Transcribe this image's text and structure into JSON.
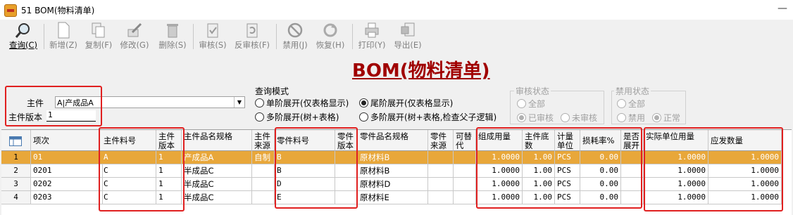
{
  "window": {
    "title": "51 BOM(物料清单)",
    "close_glyph": "—"
  },
  "toolbar": {
    "items": [
      {
        "label": "查询(C)",
        "icon": "magnifier-icon"
      },
      {
        "label": "新增(Z)",
        "icon": "new-doc-icon"
      },
      {
        "label": "复制(F)",
        "icon": "copy-icon"
      },
      {
        "label": "修改(G)",
        "icon": "edit-icon"
      },
      {
        "label": "删除(S)",
        "icon": "trash-icon"
      },
      {
        "label": "审核(S)",
        "icon": "approve-icon"
      },
      {
        "label": "反审核(F)",
        "icon": "unapprove-icon"
      },
      {
        "label": "禁用(J)",
        "icon": "disable-icon"
      },
      {
        "label": "恢复(H)",
        "icon": "restore-icon"
      },
      {
        "label": "打印(Y)",
        "icon": "printer-icon"
      },
      {
        "label": "导出(E)",
        "icon": "export-icon"
      }
    ]
  },
  "page_title": "BOM(物料清单)",
  "filters": {
    "main_part_label": "主件",
    "main_part_value": "A|产成品A",
    "main_version_label": "主件版本",
    "main_version_value": "1"
  },
  "query_mode": {
    "title": "查询模式",
    "options": [
      {
        "label": "单阶展开(仅表格显示)",
        "selected": false
      },
      {
        "label": "尾阶展开(仅表格显示)",
        "selected": true
      },
      {
        "label": "多阶展开(树+表格)",
        "selected": false
      },
      {
        "label": "多阶展开(树+表格,检查父子逻辑)",
        "selected": false
      }
    ]
  },
  "audit_status": {
    "title": "审核状态",
    "options": [
      {
        "label": "全部",
        "selected": false
      },
      {
        "label": "已审核",
        "selected": true
      },
      {
        "label": "未审核",
        "selected": false
      }
    ]
  },
  "disable_status": {
    "title": "禁用状态",
    "options": [
      {
        "label": "全部",
        "selected": false
      },
      {
        "label": "禁用",
        "selected": false
      },
      {
        "label": "正常",
        "selected": true
      }
    ]
  },
  "table": {
    "headers": [
      "项次",
      "主件料号",
      "主件版本",
      "主件品名规格",
      "主件来源",
      "零件料号",
      "零件版本",
      "零件品名规格",
      "零件来源",
      "可替代",
      "组成用量",
      "主件底数",
      "计量单位",
      "损耗率%",
      "是否展开",
      "实际单位用量",
      "应发数量"
    ],
    "rows": [
      [
        "01",
        "A",
        "1",
        "产成品A",
        "自制",
        "B",
        "",
        "原材料B",
        "",
        "",
        "1.0000",
        "1.00",
        "PCS",
        "0.00",
        "",
        "1.0000",
        "1.0000"
      ],
      [
        "0201",
        "C",
        "1",
        "半成品C",
        "",
        "B",
        "",
        "原材料B",
        "",
        "",
        "1.0000",
        "1.00",
        "PCS",
        "0.00",
        "",
        "1.0000",
        "1.0000"
      ],
      [
        "0202",
        "C",
        "1",
        "半成品C",
        "",
        "D",
        "",
        "原材料D",
        "",
        "",
        "1.0000",
        "1.00",
        "PCS",
        "0.00",
        "",
        "1.0000",
        "1.0000"
      ],
      [
        "0203",
        "C",
        "1",
        "半成品C",
        "",
        "E",
        "",
        "原材料E",
        "",
        "",
        "1.0000",
        "1.00",
        "PCS",
        "0.00",
        "",
        "1.0000",
        "1.0000"
      ]
    ],
    "row_numbers": [
      "1",
      "2",
      "3",
      "4"
    ]
  },
  "colors": {
    "highlight": "#e02020",
    "selected_row": "#e8a73a",
    "title": "#a00000"
  }
}
